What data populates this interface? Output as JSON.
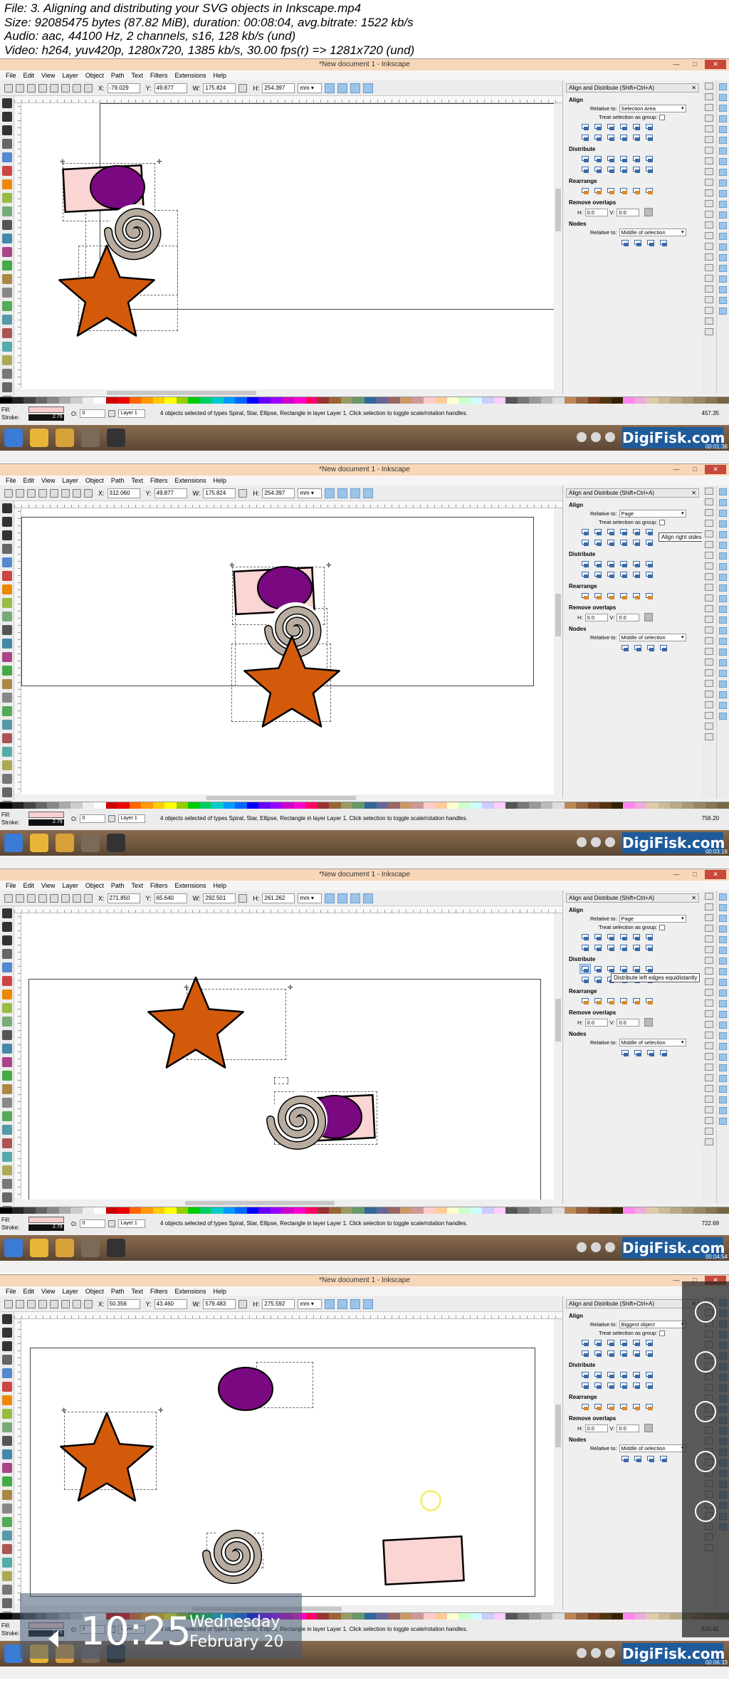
{
  "header": {
    "line1": "File: 3. Aligning and distributing your SVG objects in Inkscape.mp4",
    "line2": "Size: 92085475 bytes (87.82 MiB), duration: 00:08:04, avg.bitrate: 1522 kb/s",
    "line3": "Audio: aac, 44100 Hz, 2 channels, s16, 128 kb/s (und)",
    "line4": "Video: h264, yuv420p, 1280x720, 1385 kb/s, 30.00 fps(r) => 1281x720 (und)"
  },
  "common": {
    "window_title": "*New document 1 - Inkscape",
    "menu": [
      "File",
      "Edit",
      "View",
      "Layer",
      "Object",
      "Path",
      "Text",
      "Filters",
      "Extensions",
      "Help"
    ],
    "x_label": "X:",
    "y_label": "Y:",
    "w_label": "W:",
    "h_label": "H:",
    "unit": "mm",
    "dock_title": "Align and Distribute (Shift+Ctrl+A)",
    "align_heading": "Align",
    "relative_to_label": "Relative to:",
    "treat_as_group": "Treat selection as group:",
    "distribute_heading": "Distribute",
    "rearrange_heading": "Rearrange",
    "remove_overlaps_heading": "Remove overlaps",
    "h_short": "H:",
    "v_short": "V:",
    "overlap_value": "0.0",
    "nodes_heading": "Nodes",
    "nodes_relative": "Middle of selection",
    "fill_label": "Fill:",
    "stroke_label": "Stroke:",
    "stroke_width": "2.79",
    "opacity_label": "O:",
    "opacity_value": "0",
    "layer_name": "Layer 1",
    "status_message": "4 objects selected of types Spiral, Star, Ellipse, Rectangle in layer Layer 1. Click selection to toggle scale/rotation handles.",
    "brand": "DigiFisk.com"
  },
  "frames": [
    {
      "x": "-79.029",
      "y": "49.877",
      "w": "175.824",
      "h": "254.397",
      "relative_to": "Selection Area",
      "coord": "457.35",
      "timestamp": "00:01:38"
    },
    {
      "x": "312.060",
      "y": "49.877",
      "w": "175.824",
      "h": "254.397",
      "relative_to": "Page",
      "coord": "756.20",
      "timestamp": "00:03:16",
      "tooltip": "Align right sides"
    },
    {
      "x": "271.850",
      "y": "65.640",
      "w": "292.501",
      "h": "261.262",
      "relative_to": "Page",
      "coord": "722.69",
      "timestamp": "00:04:54",
      "tooltip": "Distribute left edges equidistantly"
    },
    {
      "x": "50.356",
      "y": "43.460",
      "w": "579.483",
      "h": "275.592",
      "relative_to": "Biggest object",
      "coord": "520.41",
      "timestamp": "00:06:33"
    }
  ],
  "lock_screen": {
    "time": "10:25",
    "day": "Wednesday",
    "date": "February 20"
  },
  "colors": {
    "rect_fill": "#fbd4d4",
    "ellipse_fill": "#7a0880",
    "star_fill": "#d35a0a",
    "spiral_fill": "#b8aca0",
    "brand_bg": "#1f5b9a"
  }
}
